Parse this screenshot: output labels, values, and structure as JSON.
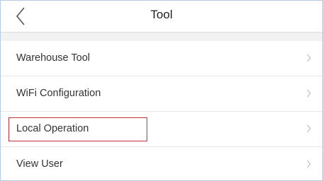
{
  "header": {
    "title": "Tool",
    "back_icon": "chevron-left-icon"
  },
  "menu": {
    "items": [
      {
        "label": "Warehouse Tool",
        "icon": "chevron-right-icon"
      },
      {
        "label": "WiFi Configuration",
        "icon": "chevron-right-icon"
      },
      {
        "label": "Local Operation",
        "icon": "chevron-right-icon",
        "highlighted": true
      },
      {
        "label": "View User",
        "icon": "chevron-right-icon"
      }
    ]
  },
  "colors": {
    "highlight_border": "#c0303a",
    "section_gap": "#f2f2f2",
    "frame_border": "#b7c9e3"
  }
}
